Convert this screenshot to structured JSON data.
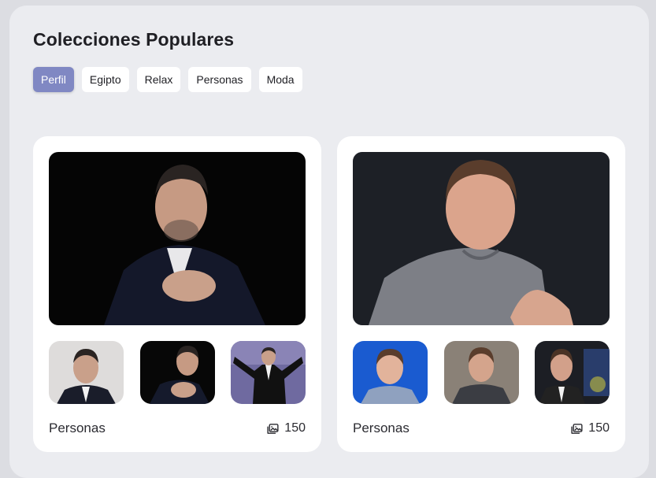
{
  "header": {
    "title": "Colecciones Populares"
  },
  "tabs": [
    {
      "label": "Perfil",
      "active": true
    },
    {
      "label": "Egipto",
      "active": false
    },
    {
      "label": "Relax",
      "active": false
    },
    {
      "label": "Personas",
      "active": false
    },
    {
      "label": "Moda",
      "active": false
    }
  ],
  "cards": [
    {
      "category": "Personas",
      "count": "150"
    },
    {
      "category": "Personas",
      "count": "150"
    }
  ],
  "colors": {
    "accent": "#8088c3",
    "panel": "#ebecf0",
    "card": "#ffffff"
  },
  "icons": {
    "count": "image-gallery-icon"
  }
}
